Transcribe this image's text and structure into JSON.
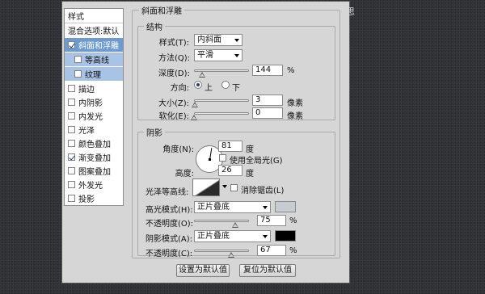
{
  "header": {
    "right_fragment": "思"
  },
  "left_panel": {
    "items": [
      {
        "label": "样式",
        "type": "header"
      },
      {
        "label": "混合选项:默认",
        "type": "plain"
      },
      {
        "label": "斜面和浮雕",
        "checked": true,
        "selected": true
      },
      {
        "label": "等高线",
        "checked": false,
        "sub": true
      },
      {
        "label": "纹理",
        "checked": false,
        "sub": true
      },
      {
        "label": "描边",
        "checked": false
      },
      {
        "label": "内阴影",
        "checked": false
      },
      {
        "label": "内发光",
        "checked": false
      },
      {
        "label": "光泽",
        "checked": false
      },
      {
        "label": "颜色叠加",
        "checked": false
      },
      {
        "label": "渐变叠加",
        "checked": true
      },
      {
        "label": "图案叠加",
        "checked": false
      },
      {
        "label": "外发光",
        "checked": false
      },
      {
        "label": "投影",
        "checked": false
      }
    ]
  },
  "bevel": {
    "section_title": "斜面和浮雕",
    "structure": {
      "title": "结构",
      "style_label": "样式(T):",
      "style_value": "内斜面",
      "technique_label": "方法(Q):",
      "technique_value": "平滑",
      "depth_label": "深度(D):",
      "depth_value": "144",
      "depth_unit": "%",
      "depth_level": 0.14,
      "direction_label": "方向:",
      "direction_up": "上",
      "direction_down": "下",
      "direction_selected": "up",
      "size_label": "大小(Z):",
      "size_value": "3",
      "size_unit": "像素",
      "size_level": 0.01,
      "soften_label": "软化(E):",
      "soften_value": "0",
      "soften_unit": "像素",
      "soften_level": 0.0
    },
    "shading": {
      "title": "阴影",
      "angle_label": "角度(N):",
      "angle_value": "81",
      "angle_unit": "度",
      "global_light_label": "使用全局光(G)",
      "global_light_checked": false,
      "altitude_label": "高度:",
      "altitude_value": "26",
      "altitude_unit": "度",
      "gloss_contour_label": "光泽等高线:",
      "anti_aliased_label": "消除锯齿(L)",
      "anti_aliased_checked": false,
      "highlight_mode_label": "高光模式(H):",
      "highlight_mode_value": "正片叠底",
      "highlight_color": "#c8ccd0",
      "highlight_opacity_label": "不透明度(O):",
      "highlight_opacity_value": "75",
      "highlight_opacity_unit": "%",
      "highlight_opacity_level": 0.75,
      "shadow_mode_label": "阴影模式(A):",
      "shadow_mode_value": "正片叠底",
      "shadow_color": "#000000",
      "shadow_opacity_label": "不透明度(C):",
      "shadow_opacity_value": "67",
      "shadow_opacity_unit": "%",
      "shadow_opacity_level": 0.67
    },
    "buttons": {
      "make_default": "设置为默认值",
      "reset_default": "复位为默认值"
    }
  },
  "colors": {
    "selected_row": "#6f9ad0",
    "sub_row": "#a8c3e6",
    "dialog_bg": "#d6d6d6"
  }
}
